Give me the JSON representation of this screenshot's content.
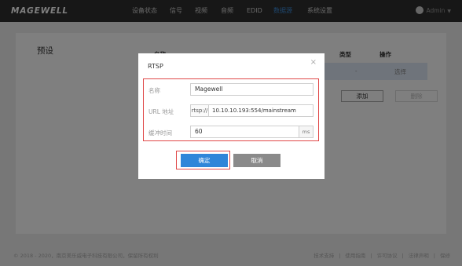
{
  "app": {
    "logo": "MAGEWELL"
  },
  "nav": {
    "items": [
      "设备状态",
      "信号",
      "视频",
      "音频",
      "EDID",
      "数据源",
      "系统设置"
    ],
    "active": "数据源",
    "active_color": "#3c8bd8"
  },
  "user": {
    "name": "Admin"
  },
  "page": {
    "title": "预设",
    "table": {
      "headers": {
        "name": "名称",
        "type": "类型",
        "operation": "操作"
      },
      "rows": [
        {
          "type": "-",
          "operation": "选择"
        }
      ]
    },
    "add_label": "添加",
    "delete_label": "删除"
  },
  "dialog": {
    "title": "RTSP",
    "close_icon": "×",
    "fields": {
      "name_label": "名称",
      "name_value": "Magewell",
      "url_label": "URL 地址",
      "url_prefix": "rtsp://",
      "url_value": "10.10.10.193:554/mainstream",
      "buffer_label": "缓冲时间",
      "buffer_value": "60",
      "buffer_unit": "ms"
    },
    "ok_label": "确定",
    "cancel_label": "取消",
    "highlight_color": "#e04848",
    "primary_color": "#2f86d9"
  },
  "footer": {
    "copyright": "© 2018 - 2020，南京美乐威电子科技有限公司，保留所有权利",
    "links": [
      "技术支持",
      "使用指南",
      "许可协议",
      "法律声明",
      "保修"
    ]
  }
}
